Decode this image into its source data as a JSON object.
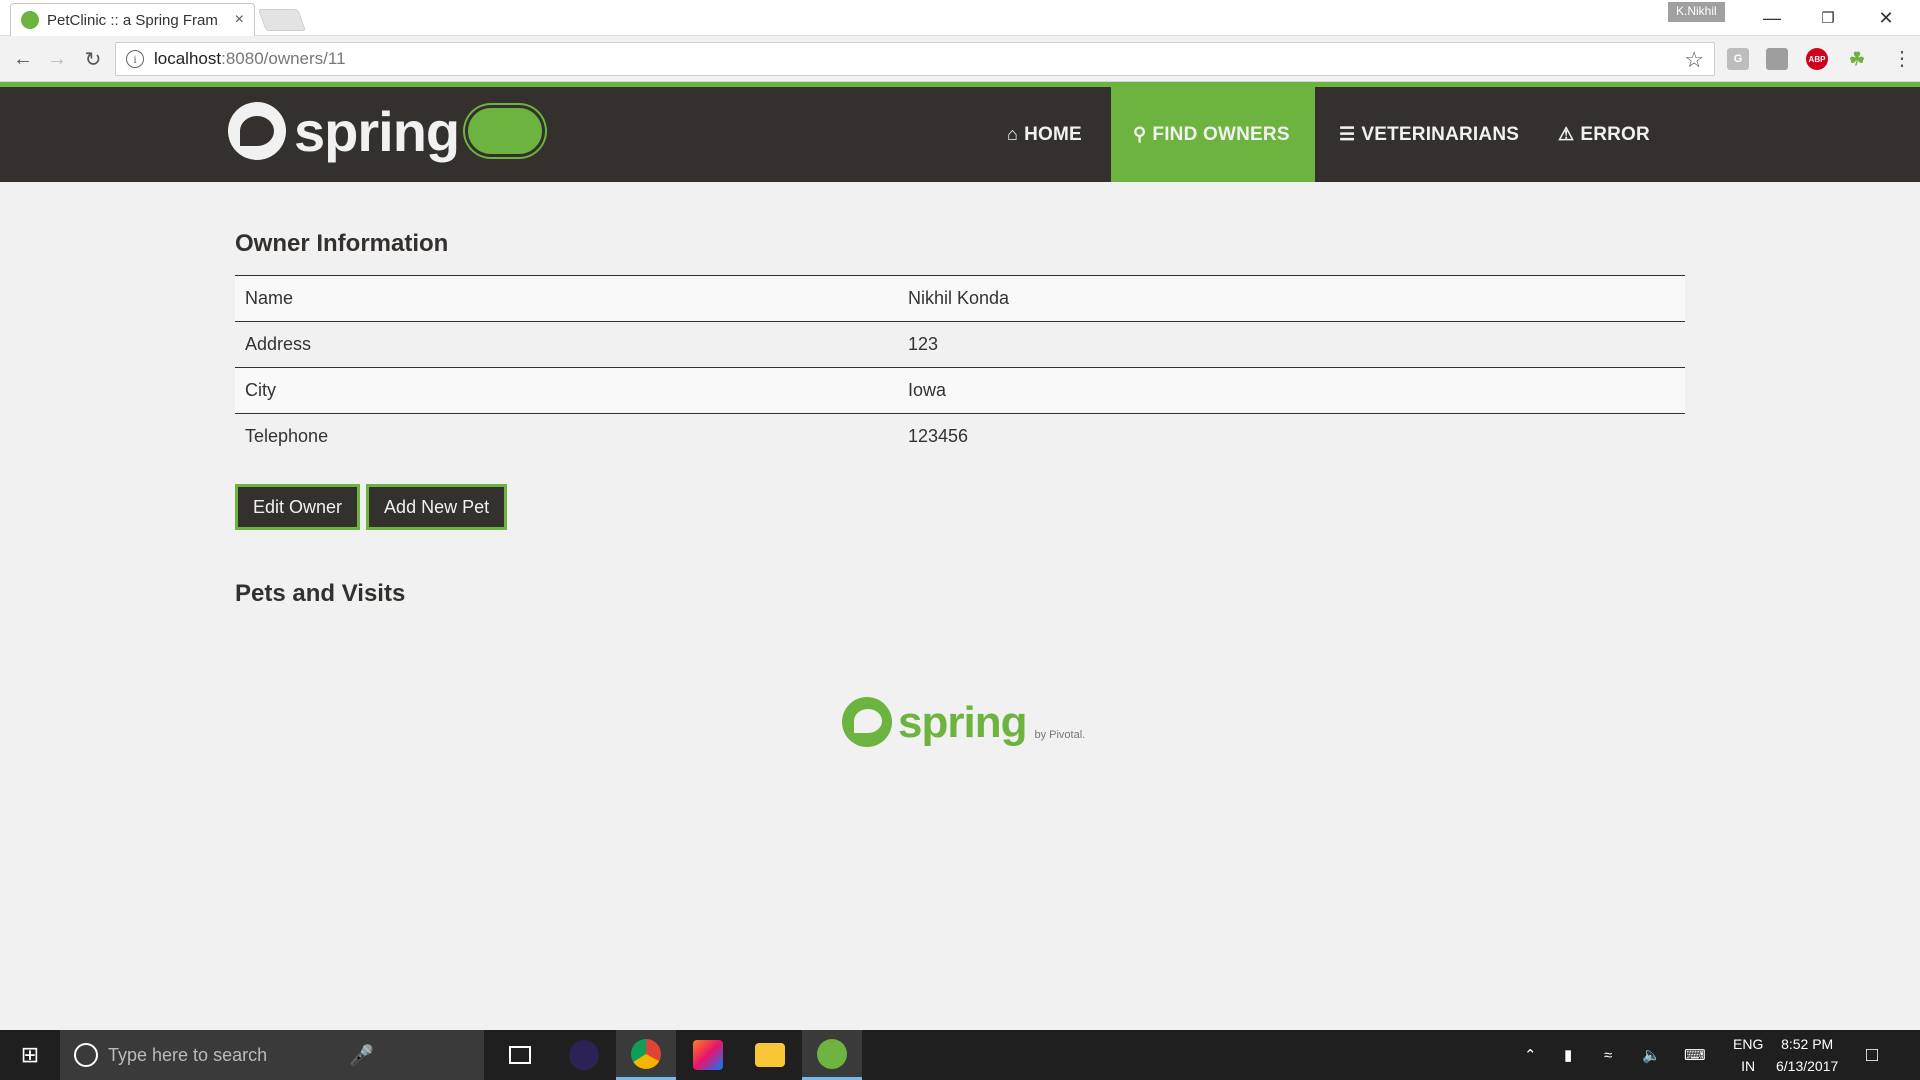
{
  "browser": {
    "tab_title": "PetClinic :: a Spring Fram",
    "tab_close": "×",
    "profile_name": "K.Nikhil",
    "url_host": "localhost",
    "url_path": ":8080/owners/11",
    "info_icon": "i",
    "ext_abp": "ABP",
    "ext_g": "G"
  },
  "navbar": {
    "brand_text": "spring",
    "items": [
      {
        "label": "HOME",
        "icon": "home-icon",
        "glyph": "⌂"
      },
      {
        "label": "FIND OWNERS",
        "icon": "search-icon",
        "glyph": "⚲"
      },
      {
        "label": "VETERINARIANS",
        "icon": "list-icon",
        "glyph": "☰"
      },
      {
        "label": "ERROR",
        "icon": "warning-icon",
        "glyph": "⚠"
      }
    ],
    "active_index": 1
  },
  "owner": {
    "heading": "Owner Information",
    "rows": [
      {
        "label": "Name",
        "value": "Nikhil Konda"
      },
      {
        "label": "Address",
        "value": "123"
      },
      {
        "label": "City",
        "value": "Iowa"
      },
      {
        "label": "Telephone",
        "value": "123456"
      }
    ]
  },
  "actions": {
    "edit_owner": "Edit Owner",
    "add_new_pet": "Add New Pet"
  },
  "pets": {
    "heading": "Pets and Visits"
  },
  "footer": {
    "brand_text": "spring",
    "by_text": "by Pivotal."
  },
  "taskbar": {
    "search_placeholder": "Type here to search",
    "lang_top": "ENG",
    "lang_bottom": "IN",
    "time": "8:52 PM",
    "date": "6/13/2017"
  },
  "colors": {
    "spring_green": "#6db33f",
    "spring_dark": "#34302d",
    "page_bg": "#f1f1f1"
  }
}
